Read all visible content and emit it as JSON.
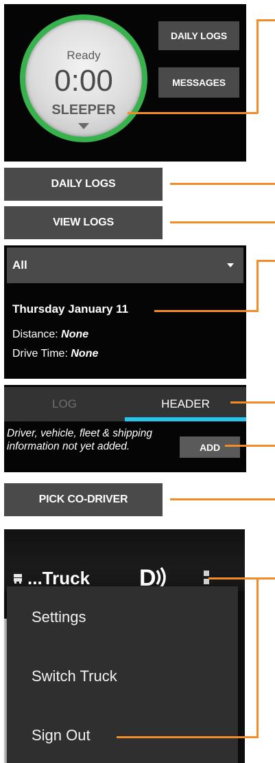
{
  "status_panel": {
    "status_label": "Ready",
    "timer": "0:00",
    "duty_status": "SLEEPER",
    "daily_logs_label": "DAILY LOGS",
    "messages_label": "MESSAGES"
  },
  "buttons": {
    "daily_logs": "DAILY LOGS",
    "view_logs": "VIEW LOGS",
    "pick_co_driver": "PICK CO-DRIVER"
  },
  "logs_panel": {
    "filter_value": "All",
    "date_heading": "Thursday January 11",
    "distance_label": "Distance:",
    "distance_value": "None",
    "drive_time_label": "Drive Time:",
    "drive_time_value": "None"
  },
  "tabs_panel": {
    "tabs": [
      {
        "label": "LOG",
        "active": false
      },
      {
        "label": "HEADER",
        "active": true
      }
    ],
    "notice": "Driver, vehicle, fleet & shipping information not yet added.",
    "add_label": "ADD"
  },
  "menu_panel": {
    "truck_title": "...Truck",
    "logo_text": "D",
    "items": [
      {
        "label": "Settings"
      },
      {
        "label": "Switch Truck"
      },
      {
        "label": "Sign Out"
      }
    ]
  },
  "colors": {
    "callout": "#f28c28",
    "accent_tab": "#29c4ee",
    "ready_ring": "#37b24d"
  },
  "icons": [
    "caret-down-icon",
    "truck-icon",
    "overflow-menu-icon",
    "signal-logo-icon"
  ]
}
